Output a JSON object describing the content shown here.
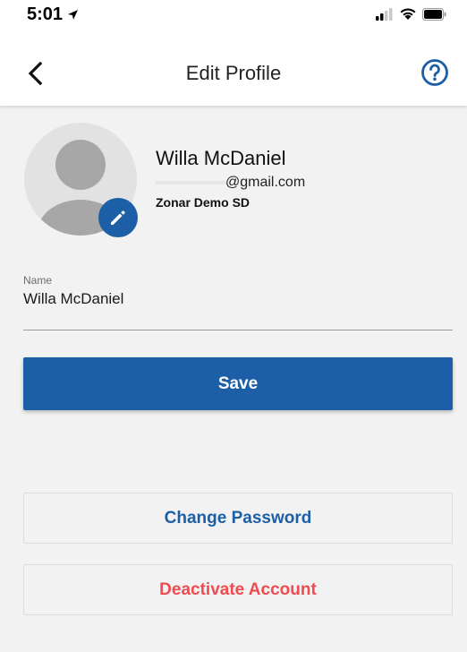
{
  "status_bar": {
    "time": "5:01"
  },
  "nav": {
    "title": "Edit Profile"
  },
  "profile": {
    "name": "Willa McDaniel",
    "email": "▯@gmail.com",
    "email_visible": "@gmail.com",
    "organization": "Zonar Demo SD"
  },
  "form": {
    "name_label": "Name",
    "name_value": "Willa McDaniel"
  },
  "actions": {
    "save_label": "Save",
    "change_password_label": "Change Password",
    "deactivate_label": "Deactivate Account"
  },
  "colors": {
    "primary": "#1d5fa6",
    "danger": "#f04b50",
    "background": "#f2f2f2"
  }
}
